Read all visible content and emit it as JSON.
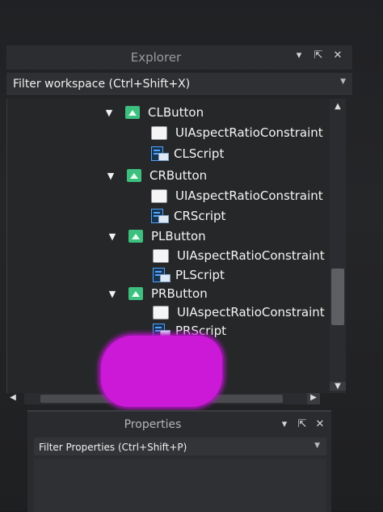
{
  "explorer": {
    "title": "Explorer",
    "filter_placeholder": "Filter workspace (Ctrl+Shift+X)",
    "tree": [
      {
        "label": "CLButton",
        "type": "frame",
        "expandable": true
      },
      {
        "label": "UIAspectRatioConstraint",
        "type": "constraint",
        "expandable": false
      },
      {
        "label": "CLScript",
        "type": "script",
        "expandable": false
      },
      {
        "label": "CRButton",
        "type": "frame",
        "expandable": true
      },
      {
        "label": "UIAspectRatioConstraint",
        "type": "constraint",
        "expandable": false
      },
      {
        "label": "CRScript",
        "type": "script",
        "expandable": false
      },
      {
        "label": "PLButton",
        "type": "frame",
        "expandable": true
      },
      {
        "label": "UIAspectRatioConstraint",
        "type": "constraint",
        "expandable": false
      },
      {
        "label": "PLScript",
        "type": "script",
        "expandable": false
      },
      {
        "label": "PRButton",
        "type": "frame",
        "expandable": true
      },
      {
        "label": "UIAspectRatioConstraint",
        "type": "constraint",
        "expandable": false
      },
      {
        "label": "PRScript",
        "type": "script",
        "expandable": false
      }
    ]
  },
  "properties": {
    "title": "Properties",
    "filter_placeholder": "Filter Properties (Ctrl+Shift+P)"
  },
  "icons": {
    "collapse": "chevron-down-icon",
    "undock": "undock-icon",
    "close": "close-icon",
    "frame": "image-button-icon",
    "constraint": "aspect-ratio-icon",
    "script": "local-script-icon"
  },
  "colors": {
    "background": "#202124",
    "frame_icon": "#3dbf7f",
    "script_icon": "#51a3ff",
    "redaction": "#cc19d8"
  }
}
